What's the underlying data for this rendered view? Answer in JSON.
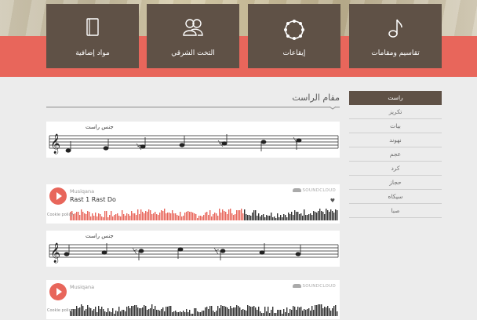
{
  "nav": {
    "tiles": [
      {
        "label": "مواد إضافية",
        "icon": "book-icon"
      },
      {
        "label": "التخت الشرقي",
        "icon": "group-icon"
      },
      {
        "label": "إيقاعات",
        "icon": "tambourine-icon"
      },
      {
        "label": "تقاسيم ومقامات",
        "icon": "music-note-icon"
      }
    ]
  },
  "sidebar": {
    "items": [
      {
        "label": "راست",
        "active": true
      },
      {
        "label": "تكريز"
      },
      {
        "label": "بيات"
      },
      {
        "label": "نهوند"
      },
      {
        "label": "عجم"
      },
      {
        "label": "كرد"
      },
      {
        "label": "حجاز"
      },
      {
        "label": "سيكاه"
      },
      {
        "label": "صبا"
      }
    ]
  },
  "main": {
    "title": "مقام الراست",
    "notations": [
      {
        "label": "جنس راست"
      },
      {
        "label": "جنس راست"
      }
    ],
    "players": [
      {
        "user": "Musiqana",
        "track": "Rast 1 Rast Do",
        "logo": "SOUNDCLOUD",
        "cookie": "Cookie policy"
      },
      {
        "user": "Musiqana",
        "track": "",
        "logo": "SOUNDCLOUD",
        "cookie": "Cookie policy"
      }
    ]
  },
  "colors": {
    "accent": "#e8665b",
    "tile": "#5f5146",
    "background": "#ececec",
    "waveform_played": "#e8665b",
    "waveform_unplayed": "#333333"
  }
}
